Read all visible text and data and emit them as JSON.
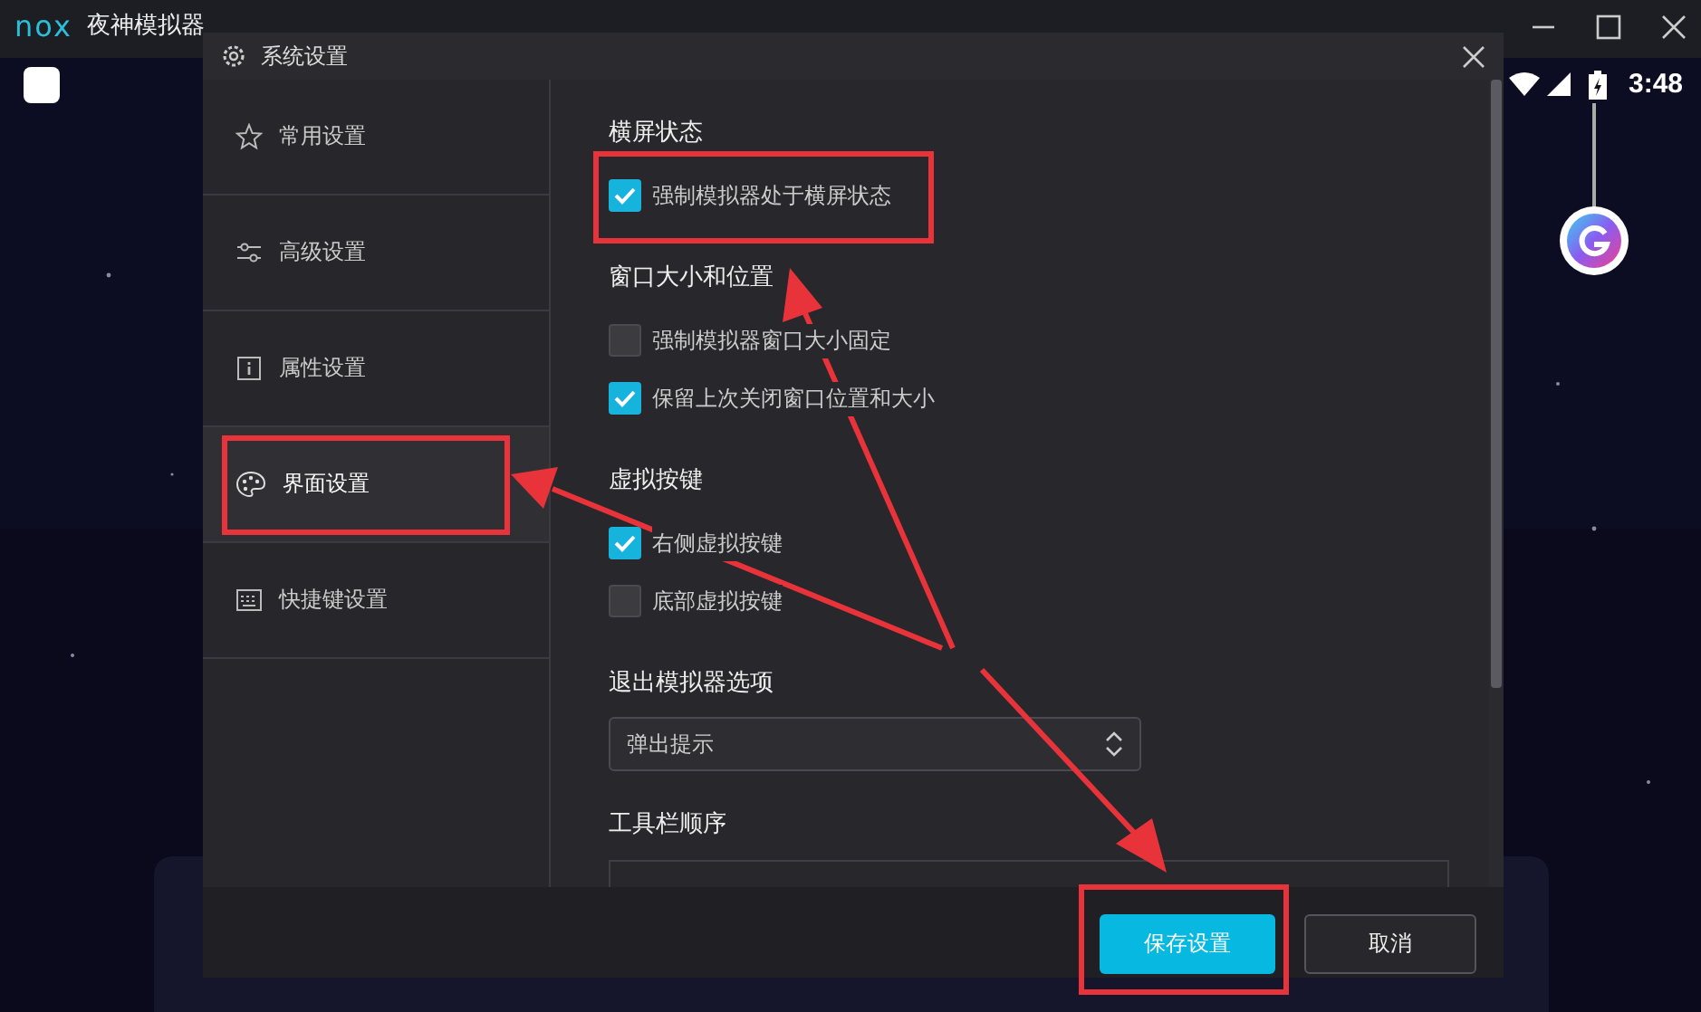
{
  "app": {
    "logo": "nox",
    "title": "夜神模拟器"
  },
  "status_bar": {
    "time": "3:48"
  },
  "dialog": {
    "title": "系统设置",
    "sidebar": [
      {
        "label": "常用设置",
        "selected": false
      },
      {
        "label": "高级设置",
        "selected": false
      },
      {
        "label": "属性设置",
        "selected": false
      },
      {
        "label": "界面设置",
        "selected": true
      },
      {
        "label": "快捷键设置",
        "selected": false
      }
    ],
    "sections": [
      {
        "kind": "checkboxes",
        "title": "横屏状态",
        "options": [
          {
            "label": "强制模拟器处于横屏状态",
            "checked": true
          }
        ]
      },
      {
        "kind": "checkboxes",
        "title": "窗口大小和位置",
        "options": [
          {
            "label": "强制模拟器窗口大小固定",
            "checked": false
          },
          {
            "label": "保留上次关闭窗口位置和大小",
            "checked": true
          }
        ]
      },
      {
        "kind": "checkboxes",
        "title": "虚拟按键",
        "options": [
          {
            "label": "右侧虚拟按键",
            "checked": true
          },
          {
            "label": "底部虚拟按键",
            "checked": false
          }
        ]
      },
      {
        "kind": "select",
        "title": "退出模拟器选项",
        "value": "弹出提示"
      },
      {
        "kind": "list",
        "title": "工具栏顺序"
      }
    ],
    "buttons": [
      {
        "label": "保存设置",
        "kind": "primary"
      },
      {
        "label": "取消",
        "kind": "secondary"
      }
    ]
  }
}
